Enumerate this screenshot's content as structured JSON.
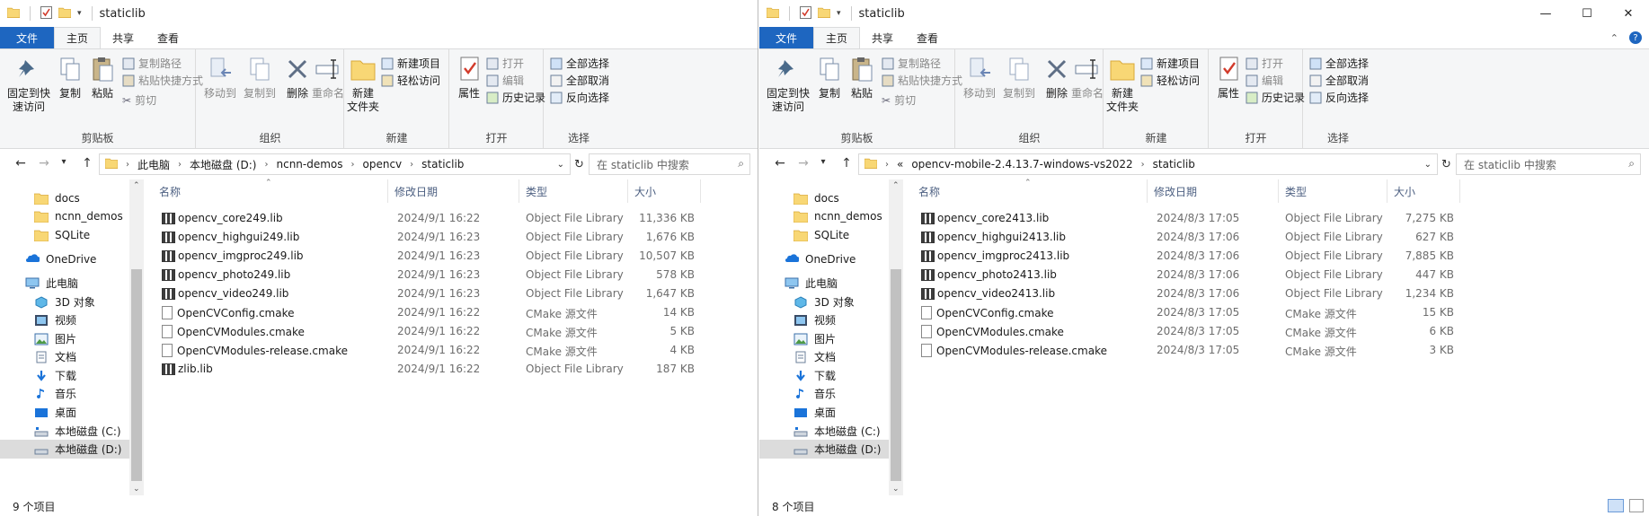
{
  "windows": [
    {
      "title": "staticlib",
      "tabs": {
        "file": "文件",
        "home": "主页",
        "share": "共享",
        "view": "查看"
      },
      "ribbon": {
        "pin": "固定到快\n速访问",
        "copy": "复制",
        "paste": "粘贴",
        "copy_path": "复制路径",
        "paste_shortcut": "粘贴快捷方式",
        "cut": "剪切",
        "clipboard": "剪贴板",
        "move_to": "移动到",
        "copy_to": "复制到",
        "delete": "删除",
        "rename": "重命名",
        "organize": "组织",
        "new_folder": "新建\n文件夹",
        "new_item": "新建项目",
        "easy_access": "轻松访问",
        "new": "新建",
        "properties": "属性",
        "open": "打开",
        "edit": "编辑",
        "history": "历史记录",
        "open_group": "打开",
        "select_all": "全部选择",
        "select_none": "全部取消",
        "invert": "反向选择",
        "select": "选择"
      },
      "breadcrumbs": [
        "此电脑",
        "本地磁盘 (D:)",
        "ncnn-demos",
        "opencv",
        "staticlib"
      ],
      "search_placeholder": "在 staticlib 中搜索",
      "nav": [
        "docs",
        "ncnn_demos",
        "SQLite",
        "OneDrive",
        "此电脑",
        "3D 对象",
        "视频",
        "图片",
        "文档",
        "下载",
        "音乐",
        "桌面",
        "本地磁盘 (C:)",
        "本地磁盘 (D:)"
      ],
      "columns": {
        "name": "名称",
        "date": "修改日期",
        "type": "类型",
        "size": "大小"
      },
      "files": [
        {
          "name": "opencv_core249.lib",
          "date": "2024/9/1 16:22",
          "type": "Object File Library",
          "size": "11,336 KB",
          "kind": "lib"
        },
        {
          "name": "opencv_highgui249.lib",
          "date": "2024/9/1 16:23",
          "type": "Object File Library",
          "size": "1,676 KB",
          "kind": "lib"
        },
        {
          "name": "opencv_imgproc249.lib",
          "date": "2024/9/1 16:23",
          "type": "Object File Library",
          "size": "10,507 KB",
          "kind": "lib"
        },
        {
          "name": "opencv_photo249.lib",
          "date": "2024/9/1 16:23",
          "type": "Object File Library",
          "size": "578 KB",
          "kind": "lib"
        },
        {
          "name": "opencv_video249.lib",
          "date": "2024/9/1 16:23",
          "type": "Object File Library",
          "size": "1,647 KB",
          "kind": "lib"
        },
        {
          "name": "OpenCVConfig.cmake",
          "date": "2024/9/1 16:22",
          "type": "CMake 源文件",
          "size": "14 KB",
          "kind": "doc"
        },
        {
          "name": "OpenCVModules.cmake",
          "date": "2024/9/1 16:22",
          "type": "CMake 源文件",
          "size": "5 KB",
          "kind": "doc"
        },
        {
          "name": "OpenCVModules-release.cmake",
          "date": "2024/9/1 16:22",
          "type": "CMake 源文件",
          "size": "4 KB",
          "kind": "doc"
        },
        {
          "name": "zlib.lib",
          "date": "2024/9/1 16:22",
          "type": "Object File Library",
          "size": "187 KB",
          "kind": "lib"
        }
      ],
      "status": "9 个项目"
    },
    {
      "title": "staticlib",
      "tabs": {
        "file": "文件",
        "home": "主页",
        "share": "共享",
        "view": "查看"
      },
      "ribbon": {
        "pin": "固定到快\n速访问",
        "copy": "复制",
        "paste": "粘贴",
        "copy_path": "复制路径",
        "paste_shortcut": "粘贴快捷方式",
        "cut": "剪切",
        "clipboard": "剪贴板",
        "move_to": "移动到",
        "copy_to": "复制到",
        "delete": "删除",
        "rename": "重命名",
        "organize": "组织",
        "new_folder": "新建\n文件夹",
        "new_item": "新建项目",
        "easy_access": "轻松访问",
        "new": "新建",
        "properties": "属性",
        "open": "打开",
        "edit": "编辑",
        "history": "历史记录",
        "open_group": "打开",
        "select_all": "全部选择",
        "select_none": "全部取消",
        "invert": "反向选择",
        "select": "选择"
      },
      "breadcrumbs": [
        "«",
        "opencv-mobile-2.4.13.7-windows-vs2022",
        "staticlib"
      ],
      "search_placeholder": "在 staticlib 中搜索",
      "nav": [
        "docs",
        "ncnn_demos",
        "SQLite",
        "OneDrive",
        "此电脑",
        "3D 对象",
        "视频",
        "图片",
        "文档",
        "下载",
        "音乐",
        "桌面",
        "本地磁盘 (C:)",
        "本地磁盘 (D:)"
      ],
      "columns": {
        "name": "名称",
        "date": "修改日期",
        "type": "类型",
        "size": "大小"
      },
      "files": [
        {
          "name": "opencv_core2413.lib",
          "date": "2024/8/3 17:05",
          "type": "Object File Library",
          "size": "7,275 KB",
          "kind": "lib"
        },
        {
          "name": "opencv_highgui2413.lib",
          "date": "2024/8/3 17:06",
          "type": "Object File Library",
          "size": "627 KB",
          "kind": "lib"
        },
        {
          "name": "opencv_imgproc2413.lib",
          "date": "2024/8/3 17:06",
          "type": "Object File Library",
          "size": "7,885 KB",
          "kind": "lib"
        },
        {
          "name": "opencv_photo2413.lib",
          "date": "2024/8/3 17:06",
          "type": "Object File Library",
          "size": "447 KB",
          "kind": "lib"
        },
        {
          "name": "opencv_video2413.lib",
          "date": "2024/8/3 17:06",
          "type": "Object File Library",
          "size": "1,234 KB",
          "kind": "lib"
        },
        {
          "name": "OpenCVConfig.cmake",
          "date": "2024/8/3 17:05",
          "type": "CMake 源文件",
          "size": "15 KB",
          "kind": "doc"
        },
        {
          "name": "OpenCVModules.cmake",
          "date": "2024/8/3 17:05",
          "type": "CMake 源文件",
          "size": "6 KB",
          "kind": "doc"
        },
        {
          "name": "OpenCVModules-release.cmake",
          "date": "2024/8/3 17:05",
          "type": "CMake 源文件",
          "size": "3 KB",
          "kind": "doc"
        }
      ],
      "status": "8 个项目"
    }
  ],
  "colors": {
    "file_tab": "#1e66c0",
    "folder": "#f8d775",
    "header_text": "#4d6082"
  }
}
